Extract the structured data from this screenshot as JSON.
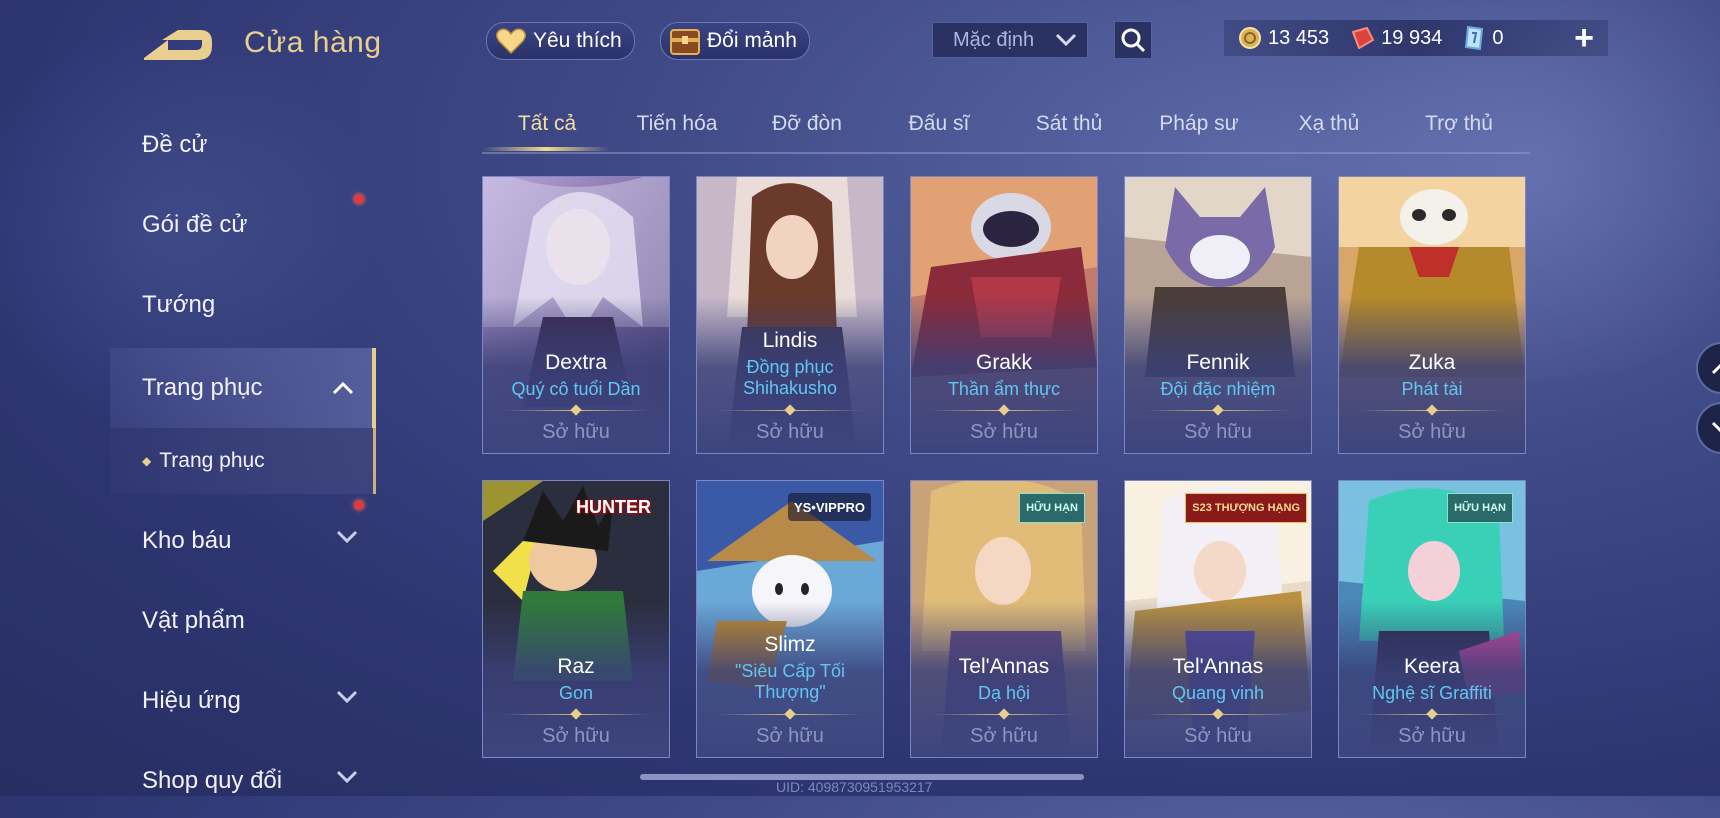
{
  "header": {
    "title": "Cửa hàng",
    "favorite_label": "Yêu thích",
    "exchange_label": "Đổi mảnh",
    "sort_select": "Mặc định",
    "currency": {
      "gold": "13 453",
      "vouchers": "19 934",
      "tickets": "0"
    },
    "plus": "+"
  },
  "sidebar": {
    "items": [
      {
        "label": "Đề cử"
      },
      {
        "label": "Gói đề cử"
      },
      {
        "label": "Tướng"
      },
      {
        "label": "Trang phục"
      },
      {
        "label": "Kho báu"
      },
      {
        "label": "Vật phẩm"
      },
      {
        "label": "Hiệu ứng"
      },
      {
        "label": "Shop quy đổi"
      }
    ],
    "sub_item": "Trang phục"
  },
  "tabs": [
    "Tất cả",
    "Tiến hóa",
    "Đỡ đòn",
    "Đấu sĩ",
    "Sát thủ",
    "Pháp sư",
    "Xạ thủ",
    "Trợ thủ"
  ],
  "cards": [
    {
      "hero": "Dextra",
      "skin": "Quý cô tuổi Dần",
      "status": "Sở hữu",
      "badge": ""
    },
    {
      "hero": "Lindis",
      "skin": "Đồng phục Shihakusho",
      "status": "Sở hữu",
      "badge": ""
    },
    {
      "hero": "Grakk",
      "skin": "Thần ẩm thực",
      "status": "Sở hữu",
      "badge": ""
    },
    {
      "hero": "Fennik",
      "skin": "Đội đặc nhiệm",
      "status": "Sở hữu",
      "badge": ""
    },
    {
      "hero": "Zuka",
      "skin": "Phát tài",
      "status": "Sở hữu",
      "badge": ""
    },
    {
      "hero": "Raz",
      "skin": "Gon",
      "status": "Sở hữu",
      "badge": "HUNTER"
    },
    {
      "hero": "Slimz",
      "skin": "\"Siêu Cấp Tối Thượng\"",
      "status": "Sở hữu",
      "badge": "YS•VIPPRO"
    },
    {
      "hero": "Tel'Annas",
      "skin": "Dạ hội",
      "status": "Sở hữu",
      "badge": "HỮU HẠN"
    },
    {
      "hero": "Tel'Annas",
      "skin": "Quang vinh",
      "status": "Sở hữu",
      "badge": "S23 THƯỢNG HẠNG"
    },
    {
      "hero": "Keera",
      "skin": "Nghệ sĩ Graffiti",
      "status": "Sở hữu",
      "badge": "HỮU HẠN"
    }
  ],
  "uid": "UID: 4098730951953217",
  "colors": {
    "accent_gold": "#e9cf8f",
    "skin_blue": "#62c6f2",
    "bg": "#3f4a86"
  }
}
